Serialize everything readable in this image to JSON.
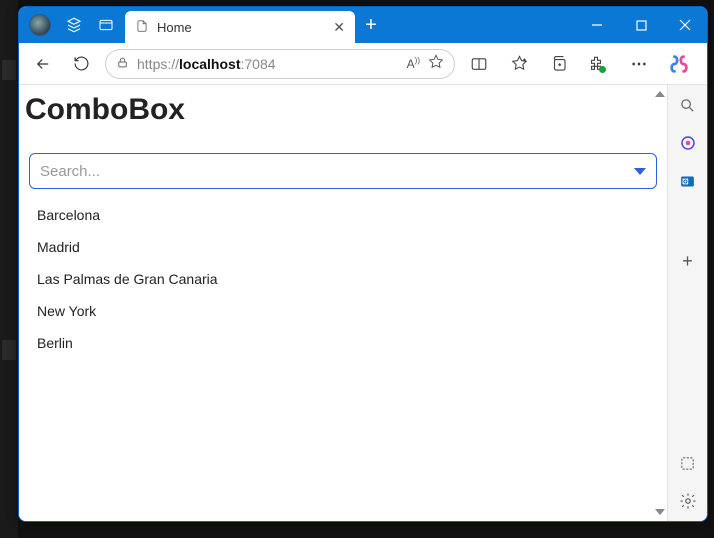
{
  "tab": {
    "title": "Home"
  },
  "url": {
    "prefix": "https://",
    "host": "localhost",
    "port": ":7084"
  },
  "page": {
    "heading": "ComboBox",
    "search_placeholder": "Search...",
    "search_value": "",
    "options": [
      "Barcelona",
      "Madrid",
      "Las Palmas de Gran Canaria",
      "New York",
      "Berlin"
    ]
  },
  "icons": {
    "workspaces": "workspaces-icon",
    "tabactions": "tab-actions-icon",
    "newtab": "+",
    "back": "back",
    "refresh": "refresh",
    "lock": "lock",
    "read": "A))",
    "star": "star",
    "split": "split",
    "favorites": "favorites",
    "collections": "collections",
    "extensions": "extensions",
    "more": "more",
    "copilot": "copilot",
    "search": "search",
    "bing": "bing",
    "outlook": "outlook",
    "add": "add",
    "screenshot": "screenshot",
    "settings": "settings"
  }
}
